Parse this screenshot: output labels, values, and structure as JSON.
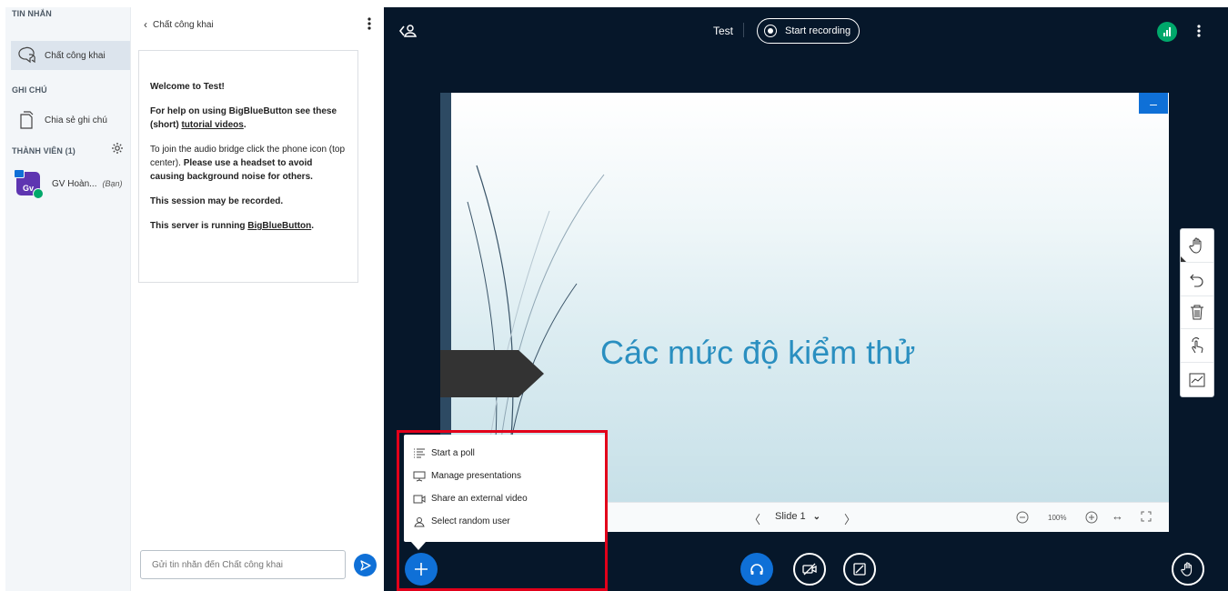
{
  "sidebar": {
    "messages_title": "TIN NHẮN",
    "public_chat_label": "Chất công khai",
    "notes_title": "GHI CHÚ",
    "shared_notes_label": "Chia sẻ ghi chú",
    "users_title": "THÀNH VIÊN (1)",
    "user": {
      "avatar_text": "Gv",
      "name": "GV Hoàn...",
      "you_label": "(Bạn)"
    }
  },
  "chat": {
    "header": "Chất công khai",
    "welcome": {
      "greeting": "Welcome to Test!",
      "help_prefix": "For help on using BigBlueButton see these (short)",
      "help_link": "tutorial videos",
      "help_suffix": ".",
      "audio_normal": "To join the audio bridge click the phone icon (top center).",
      "audio_bold": "Please use a headset to avoid causing background noise for others.",
      "recorded": "This session may be recorded.",
      "server_prefix": "This server is running",
      "server_link": "BigBlueButton",
      "server_suffix": "."
    },
    "input_placeholder": "Gửi tin nhắn đến Chất công khai"
  },
  "main": {
    "meeting_title": "Test",
    "record_label": "Start recording",
    "connection_color": "#00a86b"
  },
  "slide": {
    "title": "Các mức độ kiểm thử",
    "minimize_label": "–",
    "current_label": "Slide 1",
    "zoom_label": "100%"
  },
  "actions_menu": {
    "items": [
      {
        "label": "Start a poll",
        "icon": "poll-icon"
      },
      {
        "label": "Manage presentations",
        "icon": "presentation-icon"
      },
      {
        "label": "Share an external video",
        "icon": "external-video-icon"
      },
      {
        "label": "Select random user",
        "icon": "random-user-icon"
      }
    ]
  },
  "colors": {
    "primary": "#0f70d7",
    "dark_bg": "#06172a",
    "highlight": "#e2001a",
    "slide_title": "#2a8fc0"
  }
}
